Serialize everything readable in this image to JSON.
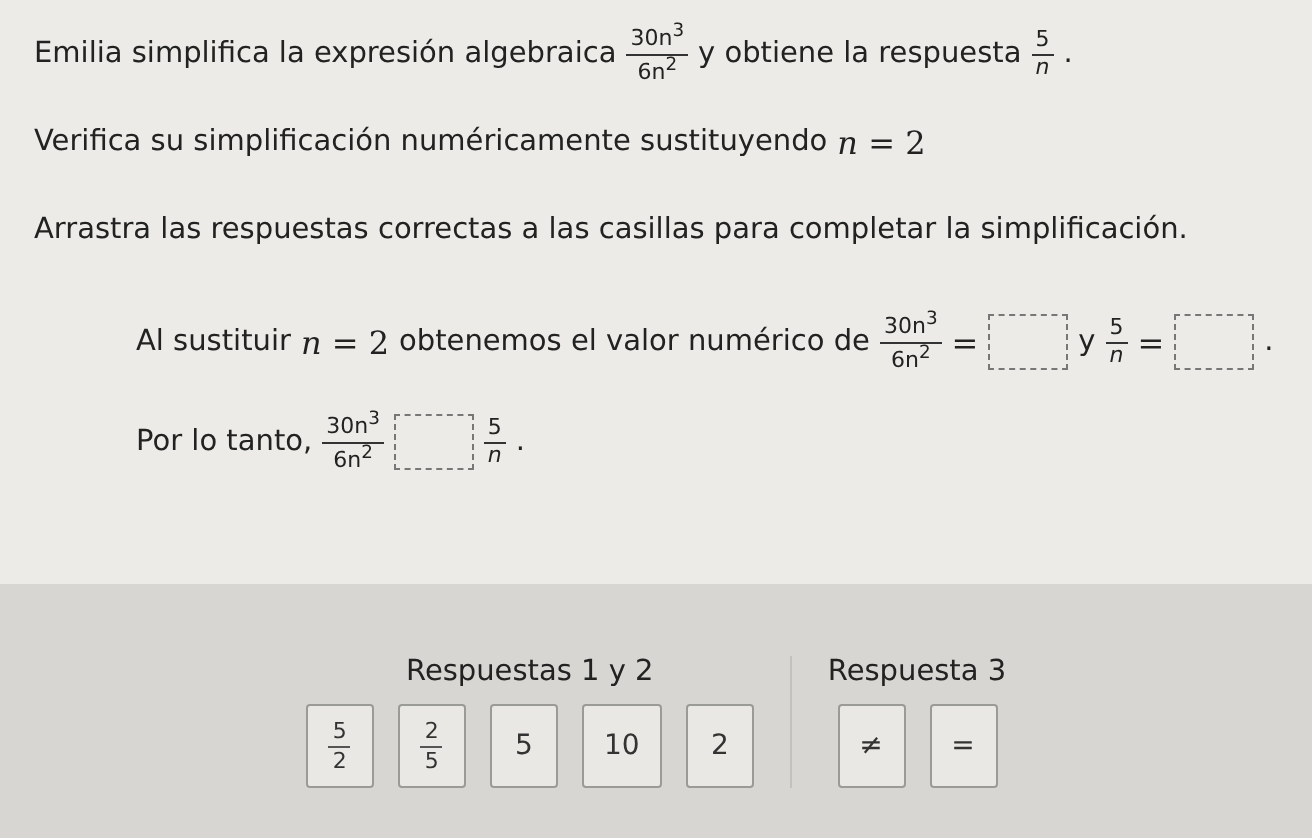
{
  "instructions": [
    {
      "parts": [
        {
          "kind": "text",
          "text": "Emilia simplifica la expresión algebraica"
        },
        {
          "kind": "frac",
          "num": "30n$^{3}$",
          "den": "6n$^{2}$"
        },
        {
          "kind": "text",
          "text": "y obtiene la respuesta"
        },
        {
          "kind": "frac",
          "num": "5",
          "den": "*n*"
        },
        {
          "kind": "text",
          "text": "."
        }
      ]
    },
    {
      "parts": [
        {
          "kind": "text",
          "text": "Verifica su simplificación numéricamente sustituyendo"
        },
        {
          "kind": "math",
          "text": "*n* = 2"
        }
      ]
    },
    {
      "parts": [
        {
          "kind": "text",
          "text": "Arrastra las respuestas correctas a las casillas para completar la simplificación."
        }
      ]
    }
  ],
  "problem": [
    {
      "parts": [
        {
          "kind": "text",
          "text": "Al sustituir"
        },
        {
          "kind": "math",
          "text": "*n* = 2"
        },
        {
          "kind": "text",
          "text": "obtenemos el valor numérico de"
        },
        {
          "kind": "frac",
          "num": "30n$^{3}$",
          "den": "6n$^{2}$"
        },
        {
          "kind": "math",
          "text": "="
        },
        {
          "kind": "blank"
        },
        {
          "kind": "text",
          "text": "y"
        },
        {
          "kind": "frac",
          "num": "5",
          "den": "*n*"
        },
        {
          "kind": "math",
          "text": "="
        },
        {
          "kind": "blank"
        },
        {
          "kind": "text",
          "text": "."
        }
      ]
    },
    {
      "parts": [
        {
          "kind": "text",
          "text": "Por lo tanto,"
        },
        {
          "kind": "frac",
          "num": "30n$^{3}$",
          "den": "6n$^{2}$"
        },
        {
          "kind": "blank"
        },
        {
          "kind": "frac",
          "num": "5",
          "den": "*n*"
        },
        {
          "kind": "text",
          "text": "."
        }
      ]
    }
  ],
  "answer_groups": [
    {
      "title": "Respuestas 1 y 2",
      "tiles": [
        {
          "kind": "frac",
          "num": "5",
          "den": "2"
        },
        {
          "kind": "frac",
          "num": "2",
          "den": "5"
        },
        {
          "kind": "text",
          "text": "5"
        },
        {
          "kind": "text",
          "text": "10"
        },
        {
          "kind": "text",
          "text": "2"
        }
      ]
    },
    {
      "title": "Respuesta 3",
      "tiles": [
        {
          "kind": "text",
          "text": "≠"
        },
        {
          "kind": "text",
          "text": "="
        }
      ]
    }
  ]
}
